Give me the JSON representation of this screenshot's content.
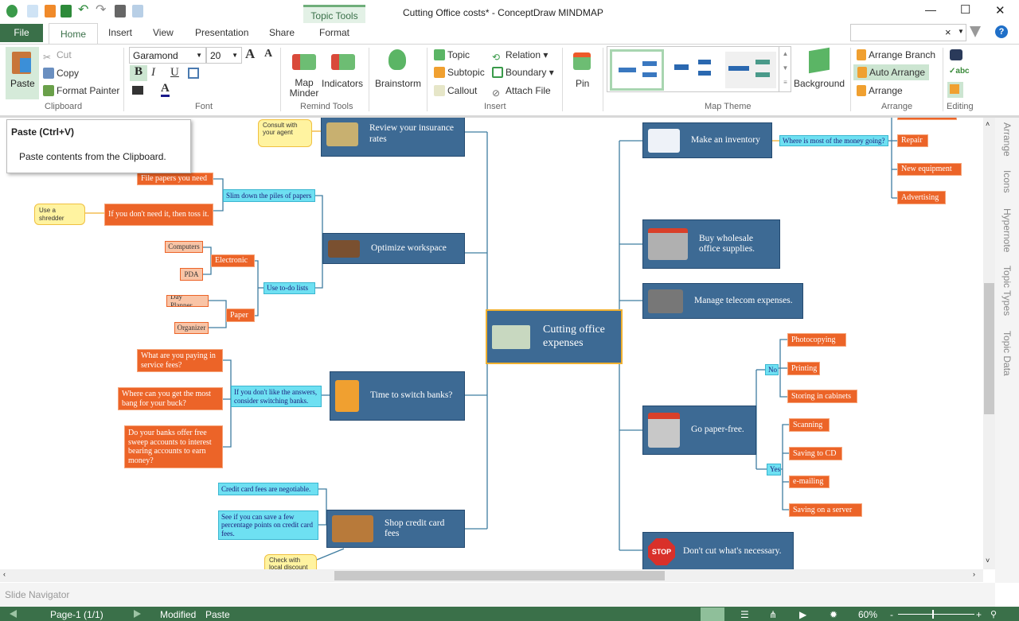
{
  "window": {
    "title": "Cutting Office costs* - ConceptDraw MINDMAP",
    "minimize": "—",
    "maximize": "☐",
    "close": "✕"
  },
  "quick_access": [
    "app-logo-icon",
    "new-icon",
    "open-icon",
    "save-icon",
    "undo-icon",
    "redo-icon",
    "print-icon",
    "print-preview-icon"
  ],
  "tabs": {
    "file": "File",
    "items": [
      "Home",
      "Insert",
      "View",
      "Presentation",
      "Share",
      "Format"
    ],
    "active": "Home",
    "contextual": "Topic Tools"
  },
  "search": {
    "value": "",
    "clear": "×",
    "help": "?"
  },
  "ribbon": {
    "clipboard": {
      "paste": "Paste",
      "cut": "Cut",
      "copy": "Copy",
      "format_painter": "Format Painter",
      "label": "Clipboard"
    },
    "font": {
      "family": "Garamond",
      "size": "20",
      "bold": "B",
      "italic": "I",
      "underline": "U",
      "grow": "A",
      "shrink": "A",
      "color": "A",
      "label": "Font"
    },
    "remind": {
      "map_minder": "Map Minder",
      "indicators": "Indicators",
      "label": "Remind Tools"
    },
    "brainstorm": "Brainstorm",
    "insert": {
      "topic": "Topic",
      "subtopic": "Subtopic",
      "callout": "Callout",
      "relation": "Relation",
      "boundary": "Boundary",
      "attach": "Attach  File",
      "label": "Insert"
    },
    "pin": "Pin",
    "theme": {
      "label": "Map Theme",
      "background": "Background"
    },
    "arrange": {
      "branch": "Arrange Branch",
      "auto": "Auto Arrange",
      "arrange": "Arrange",
      "label": "Arrange"
    },
    "editing": {
      "label": "Editing"
    }
  },
  "tooltip": {
    "title": "Paste (Ctrl+V)",
    "body": "Paste contents from the Clipboard."
  },
  "map": {
    "center": "Cutting office expenses",
    "left": {
      "insurance": {
        "title": "Review your insurance rates",
        "callout": "Consult with your agent"
      },
      "workspace": {
        "title": "Optimize workspace",
        "slim": "Slim down the piles of papers",
        "file": "File papers you need",
        "toss": "If you don't need it, then toss it.",
        "shredder": "Use a shredder",
        "todo": "Use to-do lists",
        "electronic": "Electronic",
        "computers": "Computers",
        "pda": "PDA",
        "paper": "Paper",
        "planner": "Day Planner",
        "organizer": "Organizer"
      },
      "banks": {
        "title": "Time to switch banks?",
        "sub": "If you don't like the answers, consider switching banks.",
        "q1": "What are you paying in service fees?",
        "q2": "Where can you get the most bang for your buck?",
        "q3": "Do your banks offer free sweep accounts to interest bearing accounts to earn money?"
      },
      "cards": {
        "title": "Shop credit card fees",
        "s1": "Credit card fees are negotiable.",
        "s2": "See if you can save a few percentage points on credit card fees.",
        "callout": "Check with local discount retailers"
      }
    },
    "right": {
      "inventory": {
        "title": "Make an inventory",
        "sub": "Where is most of the money going?",
        "items": [
          "Repair",
          "New equipment",
          "Advertising"
        ]
      },
      "wholesale": "Buy wholesale office supplies.",
      "telecom": "Manage  telecom expenses.",
      "paperless": {
        "title": "Go paper-free.",
        "no": "No",
        "no_items": [
          "Photocopying",
          "Printing",
          "Storing in cabinets"
        ],
        "yes": "Yes",
        "yes_items": [
          "Scanning",
          "Saving to CD",
          "e-mailing",
          "Saving on a server"
        ]
      },
      "necessary": {
        "title": "Don't cut what's necessary.",
        "stop": "STOP"
      }
    }
  },
  "side_panel": [
    "Arrange",
    "Icons",
    "Hypernote",
    "Topic Types",
    "Topic Data"
  ],
  "slide_navigator": "Slide Navigator",
  "status": {
    "page": "Page-1 (1/1)",
    "modified": "Modified",
    "action": "Paste",
    "zoom": "60%",
    "zoom_level": 60
  },
  "colors": {
    "accent": "#3a7049",
    "topic": "#3d6a94",
    "subtopic": "#6ee0f2",
    "leaf": "#ec6428",
    "callout": "#fff3a0",
    "center_border": "#f0b030"
  }
}
